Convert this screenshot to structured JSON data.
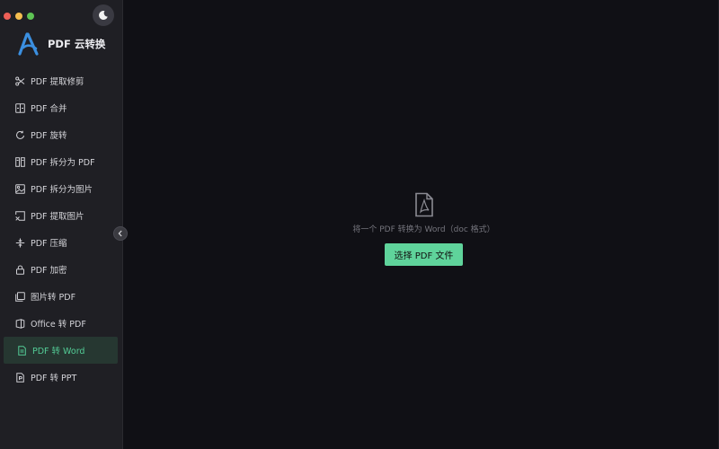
{
  "app": {
    "name": "PDF 云转换"
  },
  "sidebar": {
    "items": [
      {
        "label": "PDF 提取修剪",
        "icon": "scissors-icon"
      },
      {
        "label": "PDF 合并",
        "icon": "merge-icon"
      },
      {
        "label": "PDF 旋转",
        "icon": "rotate-icon"
      },
      {
        "label": "PDF 拆分为 PDF",
        "icon": "split-icon"
      },
      {
        "label": "PDF 拆分为图片",
        "icon": "image-split-icon"
      },
      {
        "label": "PDF 提取图片",
        "icon": "extract-image-icon"
      },
      {
        "label": "PDF 压缩",
        "icon": "compress-icon"
      },
      {
        "label": "PDF 加密",
        "icon": "lock-icon"
      },
      {
        "label": "图片转 PDF",
        "icon": "images-icon"
      },
      {
        "label": "Office 转 PDF",
        "icon": "office-icon"
      },
      {
        "label": "PDF 转 Word",
        "icon": "word-doc-icon",
        "active": true
      },
      {
        "label": "PDF 转 PPT",
        "icon": "ppt-doc-icon"
      }
    ]
  },
  "main": {
    "hint": "将一个 PDF 转换为 Word（doc 格式）",
    "select_button": "选择 PDF 文件"
  },
  "colors": {
    "accent": "#5fd39b",
    "active_text": "#53cc96",
    "sidebar_bg": "#1f1f24",
    "main_bg": "#101015"
  }
}
